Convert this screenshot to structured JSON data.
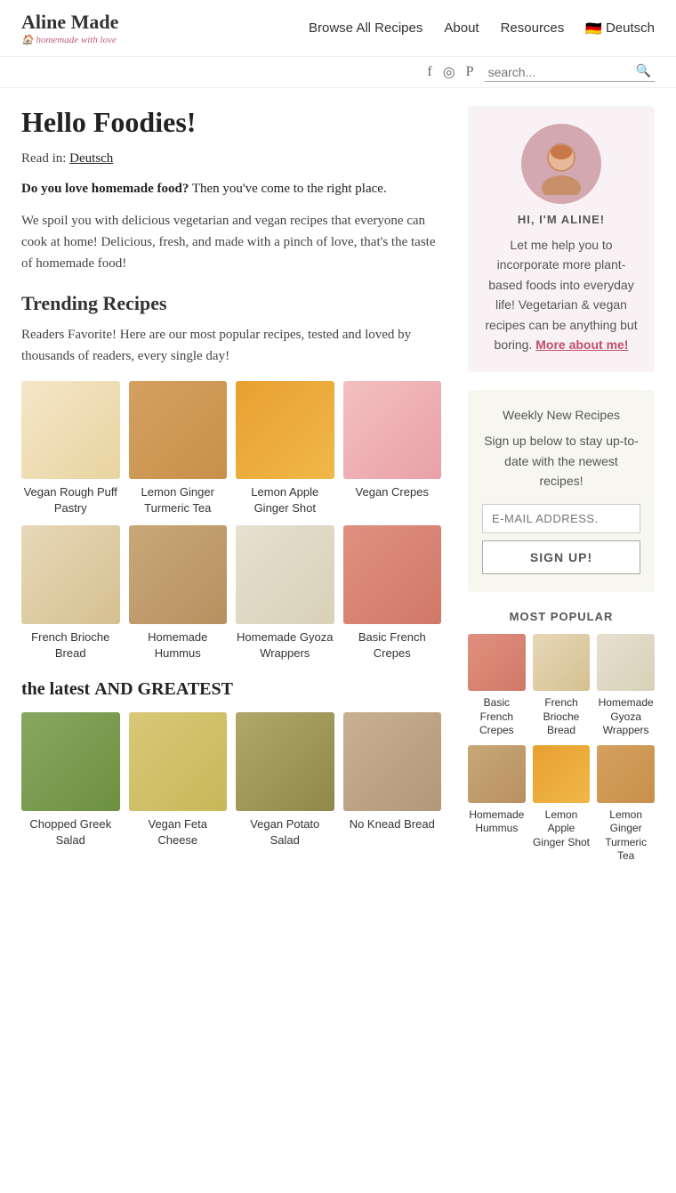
{
  "site": {
    "name": "Aline Made",
    "tagline": "homemade with love",
    "icon": "🏠"
  },
  "nav": {
    "browse": "Browse All Recipes",
    "about": "About",
    "resources": "Resources",
    "lang": "Deutsch",
    "lang_flag": "🇩🇪"
  },
  "social": {
    "facebook": "f",
    "instagram": "◎",
    "pinterest": "P"
  },
  "search": {
    "placeholder": "search..."
  },
  "main": {
    "hello": "Hello Foodies!",
    "read_in_label": "Read in:",
    "read_in_link": "Deutsch",
    "intro_bold": "Do you love homemade food?",
    "intro_bold_rest": " Then you've come to the right place.",
    "intro_body": "We spoil you with delicious vegetarian and vegan recipes that everyone can cook at home! Delicious, fresh, and made with a pinch of love, that's the taste of homemade food!",
    "trending_title": "Trending Recipes",
    "trending_desc": "Readers Favorite! Here are our most popular recipes, tested and loved by thousands of readers, every single day!",
    "latest_title": "the latest AND GREATEST"
  },
  "trending_recipes": [
    {
      "title": "Vegan Rough Puff Pastry",
      "color": "img-cream"
    },
    {
      "title": "Lemon Ginger Turmeric Tea",
      "color": "img-amber"
    },
    {
      "title": "Lemon Apple Ginger Shot",
      "color": "img-orange"
    },
    {
      "title": "Vegan Crepes",
      "color": "img-pink"
    },
    {
      "title": "French Brioche Bread",
      "color": "img-beige"
    },
    {
      "title": "Homemade Hummus",
      "color": "img-tan"
    },
    {
      "title": "Homemade Gyoza Wrappers",
      "color": "img-light"
    },
    {
      "title": "Basic French Crepes",
      "color": "img-salmon"
    }
  ],
  "latest_recipes": [
    {
      "title": "Chopped Greek Salad",
      "color": "img-green"
    },
    {
      "title": "Vegan Feta Cheese",
      "color": "img-yellow"
    },
    {
      "title": "Vegan Potato Salad",
      "color": "img-olive"
    },
    {
      "title": "No Knead Bread",
      "color": "img-warm"
    }
  ],
  "sidebar": {
    "author_greeting": "HI, I'M ALINE!",
    "author_bio": "Let me help you to incorporate more plant-based foods into everyday life! Vegetarian & vegan recipes can be anything but boring.",
    "more_link": "More about me!",
    "newsletter_title": "Weekly New Recipes",
    "newsletter_desc": "Sign up below to stay up-to-date with the newest recipes!",
    "email_placeholder": "E-MAIL ADDRESS.",
    "signup_label": "SIGN UP!",
    "most_popular_title": "MOST POPULAR"
  },
  "popular_recipes": [
    {
      "title": "Basic French Crepes",
      "color": "img-salmon"
    },
    {
      "title": "French Brioche Bread",
      "color": "img-beige"
    },
    {
      "title": "Homemade Gyoza Wrappers",
      "color": "img-light"
    },
    {
      "title": "Homemade Hummus",
      "color": "img-tan"
    },
    {
      "title": "Lemon Apple Ginger Shot",
      "color": "img-orange"
    },
    {
      "title": "Lemon Ginger Turmeric Tea",
      "color": "img-amber"
    }
  ]
}
